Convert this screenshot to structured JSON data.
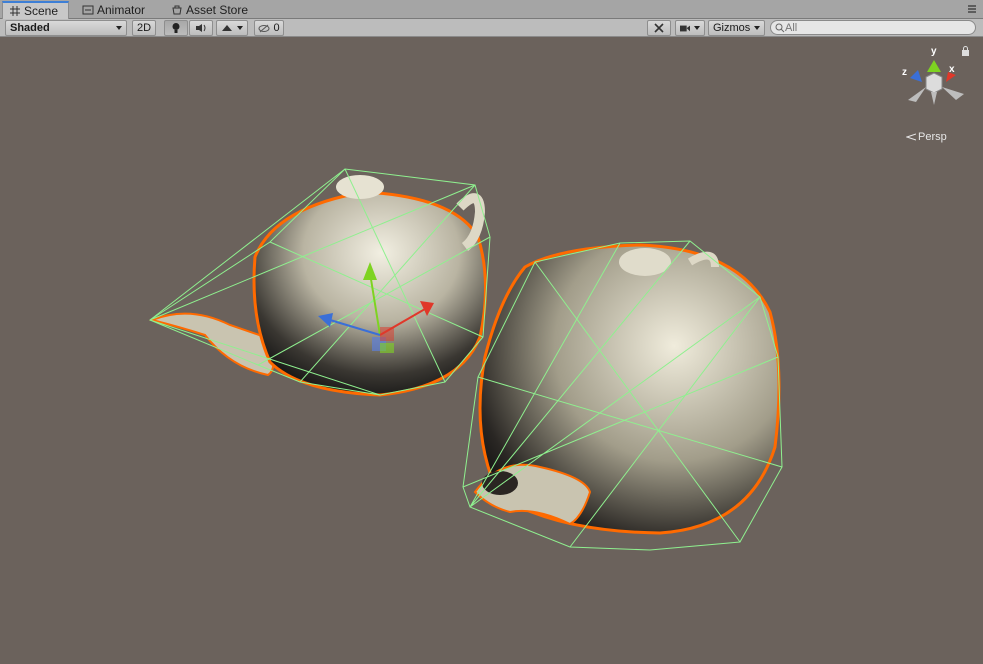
{
  "tabs": [
    {
      "label": "Scene",
      "icon": "scene-grid-icon",
      "active": true
    },
    {
      "label": "Animator",
      "icon": "animator-icon",
      "active": false
    },
    {
      "label": "Asset Store",
      "icon": "asset-store-icon",
      "active": false
    }
  ],
  "toolbar": {
    "draw_mode": "Shaded",
    "mode_2d": "2D",
    "hidden_count": "0",
    "gizmos_label": "Gizmos",
    "search_placeholder": "All"
  },
  "scene_gizmo": {
    "axis_y": "y",
    "axis_x": "x",
    "axis_z": "z",
    "projection": "Persp"
  },
  "colors": {
    "viewport_bg": "#6b625c",
    "selection_outline": "#ff6a00",
    "collider_wire": "#8ff08f",
    "axis_x": "#e0382a",
    "axis_y": "#7ed321",
    "axis_z": "#3a6fd8"
  }
}
